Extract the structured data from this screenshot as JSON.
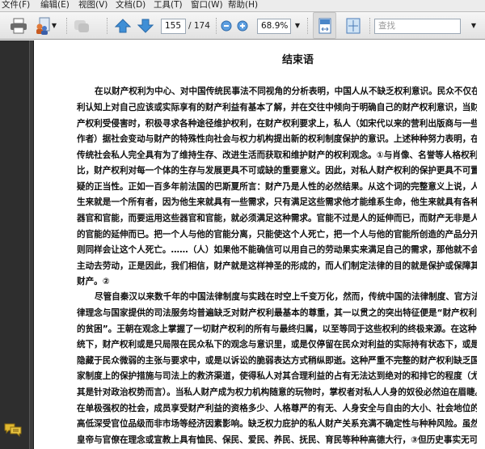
{
  "menu": [
    "文件(F)",
    "编辑(E)",
    "视图(V)",
    "文档(D)",
    "工具(T)",
    "窗口(W)",
    "帮助(H)"
  ],
  "toolbar": {
    "page_current": "155",
    "page_total": "/ 174",
    "zoom": "68.9%",
    "search_placeholder": "查找"
  },
  "document": {
    "title": "结束语",
    "lines": [
      "在以财产权利为中心、对中国传统民事法不同视角的分析表明，中国人从不缺乏权利意识。民众不仅在权",
      "利认知上对自己应该或实际享有的财产利益有基本了解，并在交往中倾向于明确自己的财产权利意识，当财",
      "产权利受侵害时，积极寻求各种途径维护权利，在财产权利要求上，私人（如宋代以来的营利出版商与一些",
      "作者）据社会变动与财产的特殊性向社会与权力机构提出新的权利制度保护的意识。上述种种努力表明，在",
      "传统社会私人完全具有为了维持生存、改进生活而获取和维护财产的权利观念。①与肖像、名誉等人格权利相",
      "比，财产权利对每一个体的生存与发展更具不可或缺的重要意义。因此，对私人财产权利的保护更具不可置",
      "疑的正当性。正如一百多年前法国的巴斯夏所言：财产乃是人性的必然结果。从这个词的完整意义上说，人",
      "生来就是一个所有者，因为他生来就具有一些需求，只有满足这些需求他才能维系生命，他生来就具有各种",
      "器官和官能，而要运用这些器官和官能，就必须满足这种需求。官能不过是人的延伸而已，而财产无非是人",
      "的官能的延伸而已。把一个人与他的官能分离，只能使这个人死亡，把一个人与他的官能所创造的产品分开，",
      "则同样会让这个人死亡。……（人）如果他不能确信可以用自己的劳动果实来满足自己的需求，那他就不会",
      "主动去劳动，正是因此，我们相信，财产就是这样神圣的形成的，而人们制定法律的目的就是保护或保障其",
      "财产。②",
      "尽管自秦汉以来数千年的中国法律制度与实践在时空上千变万化，然而，传统中国的法律制度、官方法",
      "律理念与国家提供的司法服务均普遍缺乏对财产权利最基本的尊重，其一以贯之的突出特征便是“财产权利",
      "的贫困”。王朝在观念上掌握了一切财产权利的所有与最终归属，以至等同于这些权利的终极来源。在这种传",
      "统下，财产权利或是只局限在民众私下的观念与意识里，或是仅停留在民众对利益的实际持有状态下，或是",
      "隐藏于民众微弱的主张与要求中，或是以诉讼的脆弱表达方式稍纵即逝。这种严重不完整的财产权利缺乏国",
      "家制度上的保护措施与司法上的救济渠道，使得私人对其合理利益的占有无法达到绝对的和排它的程度（尤",
      "其是针对政治权势而言）。当私人财产成为权力机构随意的玩物时，掌权者对私人人身的奴役必然迫在眉睫。",
      "在单极强权的社会，成员享受财产利益的资格多少、人格尊严的有无、人身安全与自由的大小、社会地位的",
      "高低深受官位品级而非市场等经济因素影响。缺乏权力庇护的私人财产关系充满不确定性与种种风险。虽然",
      "皇帝与官僚在理念或宣教上具有恤民、保民、爱民、养民、抚民、育民等种种高德大行，③但历史事实无可争"
    ]
  }
}
